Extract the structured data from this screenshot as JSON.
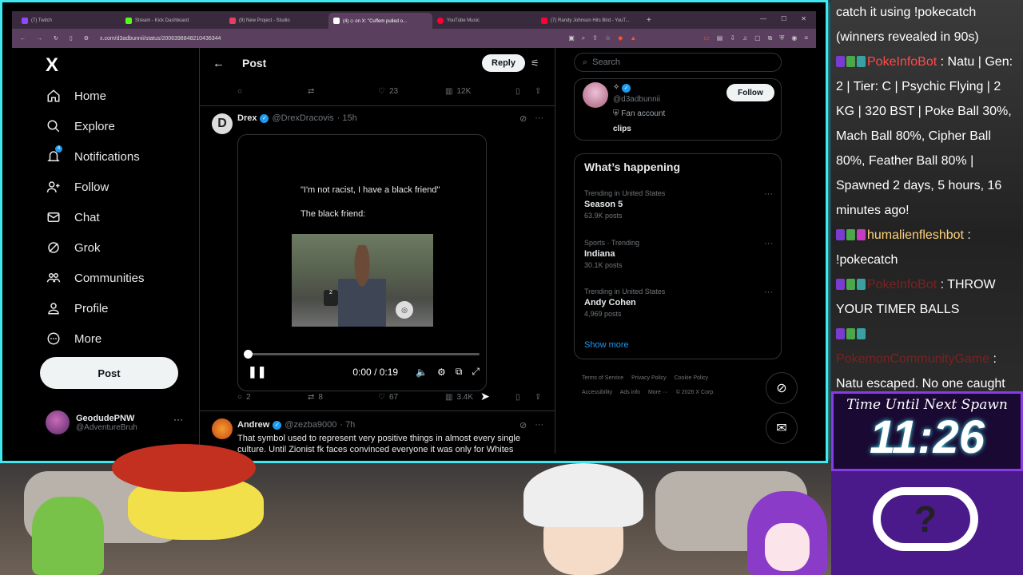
{
  "browser": {
    "tabs": [
      {
        "label": "(7) Twitch",
        "color": "#9146ff"
      },
      {
        "label": "Stream - Kick Dashboard",
        "color": "#53fc18"
      },
      {
        "label": "(9) New Project - Studio",
        "color": "#e4405f"
      },
      {
        "label": "(4) ◇ on X: \"Cuffem pulled o...",
        "color": "#ffffff",
        "active": true
      },
      {
        "label": "YouTube Music",
        "color": "#ff0033"
      },
      {
        "label": "(7) Randy Johnson Hits Bird - YouT...",
        "color": "#ff0033"
      }
    ],
    "new_tab": "+",
    "url": "x.com/d3adbunnii/status/2006398848210436344"
  },
  "nav": {
    "logo": "X",
    "items": [
      {
        "label": "Home",
        "icon": "home-icon"
      },
      {
        "label": "Explore",
        "icon": "search-icon"
      },
      {
        "label": "Notifications",
        "icon": "bell-icon",
        "badge": "4"
      },
      {
        "label": "Follow",
        "icon": "person-add-icon"
      },
      {
        "label": "Chat",
        "icon": "mail-icon"
      },
      {
        "label": "Grok",
        "icon": "grok-icon"
      },
      {
        "label": "Communities",
        "icon": "people-icon"
      },
      {
        "label": "Profile",
        "icon": "person-icon"
      },
      {
        "label": "More",
        "icon": "more-icon"
      }
    ],
    "post_label": "Post",
    "account": {
      "name": "GeodudePNW",
      "handle": "@AdventureBruh"
    }
  },
  "center": {
    "title": "Post",
    "reply_label": "Reply",
    "top_actions": {
      "likes": "23",
      "views": "12K"
    },
    "tweet1": {
      "name": "Drex",
      "handle": "@DrexDracovis",
      "age": "· 15h",
      "meme_line1": "\"I'm not racist, I have a black friend\"",
      "meme_line2": "The black friend:",
      "video_time": "0:00 / 0:19",
      "progress": 0.0,
      "replies": "2",
      "reposts": "8",
      "likes": "67",
      "views": "3.4K"
    },
    "tweet2": {
      "name": "Andrew",
      "handle": "@zezba9000",
      "age": "· 7h",
      "text": "That symbol used to represent very positive things in almost every single culture. Until Zionist fk faces convinced everyone it was only for Whites"
    }
  },
  "right": {
    "search_placeholder": "Search",
    "profile": {
      "handle": "@d3adbunnii",
      "line": "Fan account",
      "clips": "clips",
      "follow_label": "Follow"
    },
    "happening_title": "What’s happening",
    "trends": [
      {
        "context": "Trending in United States",
        "name": "Season 5",
        "count": "63.9K posts"
      },
      {
        "context": "Sports · Trending",
        "name": "Indiana",
        "count": "30.1K posts"
      },
      {
        "context": "Trending in United States",
        "name": "Andy Cohen",
        "count": "4,969 posts"
      }
    ],
    "show_more": "Show more",
    "footer": [
      "Terms of Service",
      "Privacy Policy",
      "Cookie Policy",
      "Accessibility",
      "Ads info",
      "More ···",
      "© 2026 X Corp."
    ]
  },
  "chat": {
    "lines": [
      {
        "type": "plain",
        "text": "catch it using !pokecatch (winners revealed in 90s)"
      },
      {
        "type": "bot",
        "user": "PokeInfoBot",
        "text": ": Natu | Gen: 2 | Tier: C | Psychic Flying | 2 KG | 320 BST | Poke Ball 30%, Mach Ball 80%, Cipher Ball 80%, Feather Ball 80% | Spawned 2 days, 5 hours, 16 minutes ago!"
      },
      {
        "type": "user",
        "user": "humalienfleshbot",
        "text": ": !pokecatch"
      },
      {
        "type": "bot2",
        "user": "PokeInfoBot",
        "text": ": THROW YOUR TIMER BALLS"
      },
      {
        "type": "bot2",
        "user": "PokemonCommunityGame",
        "text": ": Natu escaped. No one caught it."
      }
    ]
  },
  "timer": {
    "label": "Time Until Next Spawn",
    "value": "11:26"
  },
  "colors": {
    "accent": "#1d9bf0",
    "frame": "#3fe7ee",
    "overlay": "#8a3be8"
  }
}
